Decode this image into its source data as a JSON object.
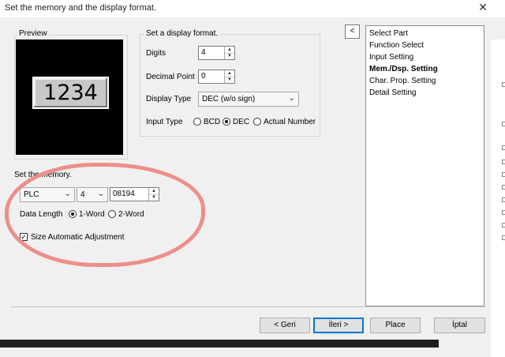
{
  "window": {
    "title": "Set the memory and the display format."
  },
  "preview": {
    "label": "Preview",
    "digits": "1234"
  },
  "display_format": {
    "label": "Set a display format.",
    "digits": {
      "label": "Digits",
      "value": "4"
    },
    "decimal_point": {
      "label": "Decimal Point",
      "value": "0"
    },
    "display_type": {
      "label": "Display Type",
      "value": "DEC (w/o sign)"
    },
    "input_type": {
      "label": "Input Type",
      "options": [
        "BCD",
        "DEC",
        "Actual Number"
      ],
      "selected": "DEC"
    }
  },
  "memory": {
    "label": "Set the memory.",
    "device": "PLC",
    "index": "4",
    "address": "08194",
    "data_length": {
      "label": "Data Length",
      "options": [
        "1-Word",
        "2-Word"
      ],
      "selected": "1-Word"
    },
    "size_auto": {
      "label": "Size Automatic Adjustment",
      "checked": true
    }
  },
  "nav": {
    "items": [
      "Select Part",
      "Function Select",
      "Input Setting",
      "Mem./Dsp. Setting",
      "Char. Prop. Setting",
      "Detail Setting"
    ],
    "active": "Mem./Dsp. Setting"
  },
  "buttons": {
    "back": "< Geri",
    "next": "İleri >",
    "place": "Place",
    "cancel": "İptal"
  },
  "colors": {
    "annotation": "#ec8f8a",
    "preview_bg": "#000000",
    "default_button_border": "#0078d7"
  }
}
